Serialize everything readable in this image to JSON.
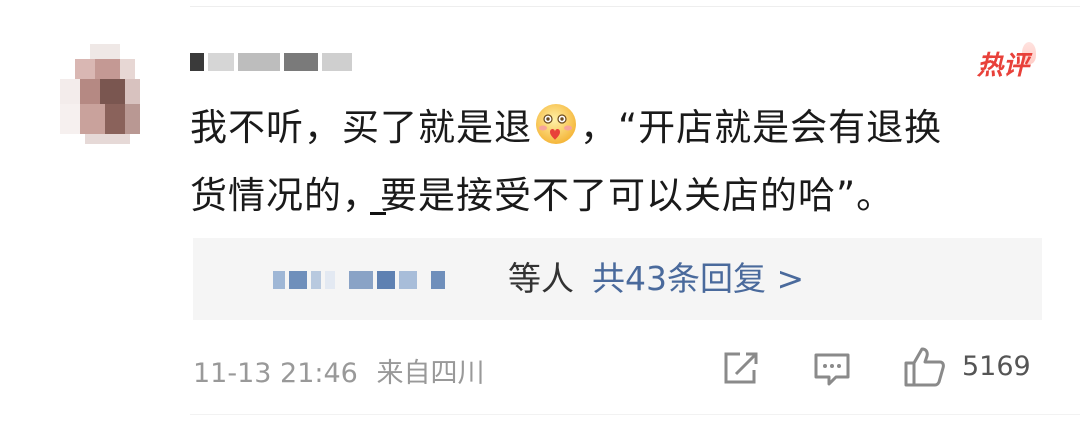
{
  "comment": {
    "badge": "热评",
    "text_line1": "我不听，买了就是退",
    "text_after_emoji": "，“开店就是会有退换",
    "text_line2": "货情况的，要是接受不了可以关店的哈”。",
    "emoji": "blushing-heart-emoji"
  },
  "replies": {
    "suffix": "等人",
    "link": "共43条回复 >"
  },
  "meta": {
    "timestamp": "11-13 21:46",
    "location": "来自四川"
  },
  "actions": {
    "like_count": "5169",
    "icons": [
      "share-icon",
      "comment-icon",
      "like-icon"
    ]
  },
  "colors": {
    "badge": "#e8413a",
    "reply_link": "#4a6a9c",
    "meta": "#999999",
    "reply_box": "#f5f5f5"
  }
}
